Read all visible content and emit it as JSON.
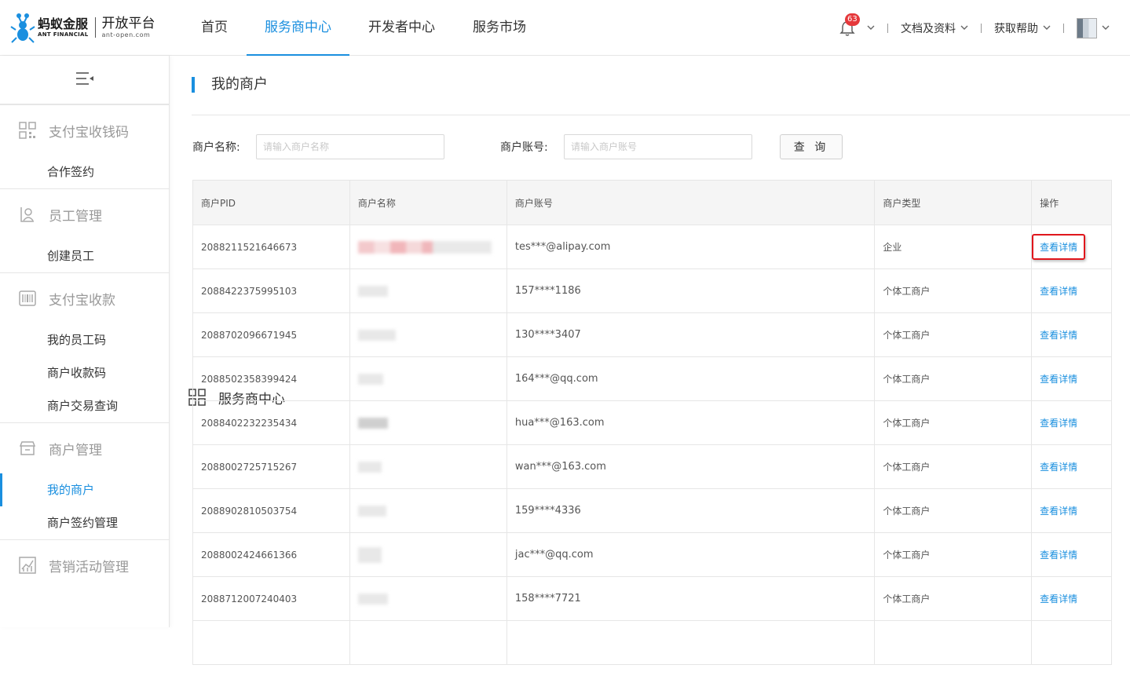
{
  "header": {
    "logo": {
      "brand_cn": "蚂蚁金服",
      "brand_en": "ANT FINANCIAL",
      "product_cn": "开放平台",
      "product_en": "ant-open.com"
    },
    "nav": [
      {
        "label": "首页"
      },
      {
        "label": "服务商中心",
        "active": true
      },
      {
        "label": "开发者中心"
      },
      {
        "label": "服务市场"
      }
    ],
    "notifications": {
      "icon": "bell-icon",
      "count": "63"
    },
    "links": {
      "docs": "文档及资料",
      "help": "获取帮助"
    }
  },
  "sidebar": {
    "collapse_icon": "menu-collapse-icon",
    "groups": [
      {
        "title": "服务商中心",
        "icon": "grid-icon",
        "items": []
      },
      {
        "title": "支付宝收钱码",
        "icon": "qrcode-icon",
        "items": [
          "合作签约"
        ]
      },
      {
        "title": "员工管理",
        "icon": "staff-icon",
        "items": [
          "创建员工"
        ]
      },
      {
        "title": "支付宝收款",
        "icon": "barcode-icon",
        "items": [
          "我的员工码",
          "商户收款码",
          "商户交易查询"
        ]
      },
      {
        "title": "商户管理",
        "icon": "store-icon",
        "items": [
          "我的商户",
          "商户签约管理"
        ]
      },
      {
        "title": "营销活动管理",
        "icon": "chart-icon",
        "items": []
      }
    ],
    "active_item": "我的商户"
  },
  "main": {
    "title": "我的商户",
    "filter": {
      "name_label": "商户名称:",
      "name_placeholder": "请输入商户名称",
      "account_label": "商户账号:",
      "account_placeholder": "请输入商户账号",
      "query_button": "查 询"
    },
    "table": {
      "columns": [
        "商户PID",
        "商户名称",
        "商户账号",
        "商户类型",
        "操作"
      ],
      "rows": [
        {
          "pid": "2088211521646673",
          "account": "tes***@alipay.com",
          "type": "企业",
          "action": "查看详情",
          "highlight": true
        },
        {
          "pid": "2088422375995103",
          "account": "157****1186",
          "type": "个体工商户",
          "action": "查看详情"
        },
        {
          "pid": "2088702096671945",
          "account": "130****3407",
          "type": "个体工商户",
          "action": "查看详情"
        },
        {
          "pid": "2088502358399424",
          "account": "164***@qq.com",
          "type": "个体工商户",
          "action": "查看详情"
        },
        {
          "pid": "2088402232235434",
          "account": "hua***@163.com",
          "type": "个体工商户",
          "action": "查看详情"
        },
        {
          "pid": "2088002725715267",
          "account": "wan***@163.com",
          "type": "个体工商户",
          "action": "查看详情"
        },
        {
          "pid": "2088902810503754",
          "account": "159****4336",
          "type": "个体工商户",
          "action": "查看详情"
        },
        {
          "pid": "2088002424661366",
          "account": "jac***@qq.com",
          "type": "个体工商户",
          "action": "查看详情"
        },
        {
          "pid": "2088712007240403",
          "account": "158****7721",
          "type": "个体工商户",
          "action": "查看详情"
        }
      ]
    }
  },
  "colors": {
    "accent": "#1a8fdf",
    "badge": "#e5383b",
    "highlight_border": "#e0161c"
  }
}
